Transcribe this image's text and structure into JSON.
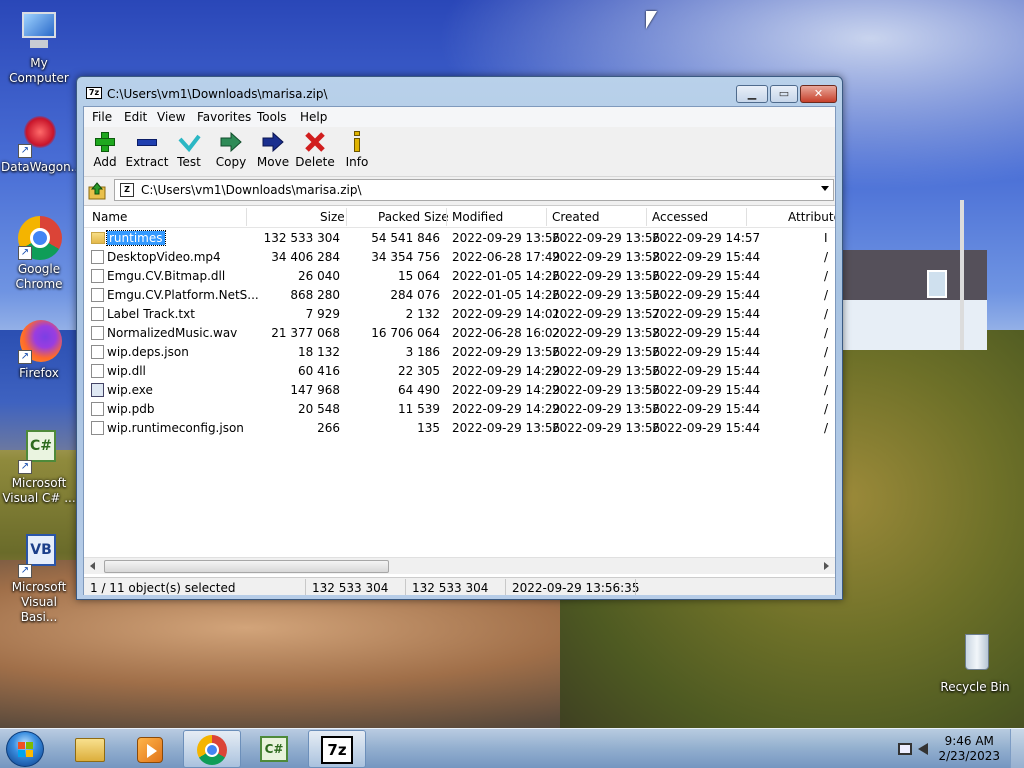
{
  "desktop": {
    "icons": [
      {
        "label": "My Computer",
        "icon": "computer-icon"
      },
      {
        "label": "DataWagon...",
        "icon": "datawagon-icon"
      },
      {
        "label": "Google Chrome",
        "icon": "chrome-icon"
      },
      {
        "label": "Firefox",
        "icon": "firefox-icon"
      },
      {
        "label": "Microsoft Visual C# ...",
        "icon": "visual-csharp-icon"
      },
      {
        "label": "Microsoft Visual Basi...",
        "icon": "visual-basic-icon"
      },
      {
        "label": "Recycle Bin",
        "icon": "recycle-bin-icon"
      }
    ]
  },
  "window": {
    "title": "C:\\Users\\vm1\\Downloads\\marisa.zip\\",
    "app_icon_text": "7z",
    "menu": [
      "File",
      "Edit",
      "View",
      "Favorites",
      "Tools",
      "Help"
    ],
    "toolbar": [
      {
        "label": "Add",
        "icon": "plus-icon",
        "color": "#1fa81f"
      },
      {
        "label": "Extract",
        "icon": "minus-icon",
        "color": "#1f3fb0"
      },
      {
        "label": "Test",
        "icon": "check-icon",
        "color": "#2bb7c4"
      },
      {
        "label": "Copy",
        "icon": "double-arrow-icon",
        "color": "#2e8b57"
      },
      {
        "label": "Move",
        "icon": "arrow-right-icon",
        "color": "#1a2f8f"
      },
      {
        "label": "Delete",
        "icon": "x-icon",
        "color": "#d11e1e"
      },
      {
        "label": "Info",
        "icon": "info-icon",
        "color": "#e0b400"
      }
    ],
    "address": "C:\\Users\\vm1\\Downloads\\marisa.zip\\",
    "columns": [
      "Name",
      "Size",
      "Packed Size",
      "Modified",
      "Created",
      "Accessed",
      "Attribute"
    ],
    "files": [
      {
        "name": "runtimes",
        "type": "folder",
        "size": "132 533 304",
        "packed": "54 541 846",
        "modified": "2022-09-29 13:56",
        "created": "2022-09-29 13:56",
        "accessed": "2022-09-29 14:57",
        "attr": "I",
        "selected": true
      },
      {
        "name": "DesktopVideo.mp4",
        "type": "video",
        "size": "34 406 284",
        "packed": "34 354 756",
        "modified": "2022-06-28 17:49",
        "created": "2022-09-29 13:58",
        "accessed": "2022-09-29 15:44",
        "attr": "/"
      },
      {
        "name": "Emgu.CV.Bitmap.dll",
        "type": "dll",
        "size": "26 040",
        "packed": "15 064",
        "modified": "2022-01-05 14:26",
        "created": "2022-09-29 13:56",
        "accessed": "2022-09-29 15:44",
        "attr": "/"
      },
      {
        "name": "Emgu.CV.Platform.NetS...",
        "type": "dll",
        "size": "868 280",
        "packed": "284 076",
        "modified": "2022-01-05 14:26",
        "created": "2022-09-29 13:56",
        "accessed": "2022-09-29 15:44",
        "attr": "/"
      },
      {
        "name": "Label Track.txt",
        "type": "file",
        "size": "7 929",
        "packed": "2 132",
        "modified": "2022-09-29 14:01",
        "created": "2022-09-29 13:57",
        "accessed": "2022-09-29 15:44",
        "attr": "/"
      },
      {
        "name": "NormalizedMusic.wav",
        "type": "audio",
        "size": "21 377 068",
        "packed": "16 706 064",
        "modified": "2022-06-28 16:02",
        "created": "2022-09-29 13:58",
        "accessed": "2022-09-29 15:44",
        "attr": "/"
      },
      {
        "name": "wip.deps.json",
        "type": "file",
        "size": "18 132",
        "packed": "3 186",
        "modified": "2022-09-29 13:56",
        "created": "2022-09-29 13:56",
        "accessed": "2022-09-29 15:44",
        "attr": "/"
      },
      {
        "name": "wip.dll",
        "type": "dll",
        "size": "60 416",
        "packed": "22 305",
        "modified": "2022-09-29 14:29",
        "created": "2022-09-29 13:56",
        "accessed": "2022-09-29 15:44",
        "attr": "/"
      },
      {
        "name": "wip.exe",
        "type": "exe",
        "size": "147 968",
        "packed": "64 490",
        "modified": "2022-09-29 14:29",
        "created": "2022-09-29 13:56",
        "accessed": "2022-09-29 15:44",
        "attr": "/"
      },
      {
        "name": "wip.pdb",
        "type": "file",
        "size": "20 548",
        "packed": "11 539",
        "modified": "2022-09-29 14:29",
        "created": "2022-09-29 13:56",
        "accessed": "2022-09-29 15:44",
        "attr": "/"
      },
      {
        "name": "wip.runtimeconfig.json",
        "type": "file",
        "size": "266",
        "packed": "135",
        "modified": "2022-09-29 13:56",
        "created": "2022-09-29 13:56",
        "accessed": "2022-09-29 15:44",
        "attr": "/"
      }
    ],
    "status": {
      "selection": "1 / 11 object(s) selected",
      "size": "132 533 304",
      "packed": "132 533 304",
      "modified": "2022-09-29 13:56:35"
    }
  },
  "taskbar": {
    "apps": [
      {
        "name": "file-explorer",
        "icon": "folder-icon"
      },
      {
        "name": "media-player",
        "icon": "media-player-icon"
      },
      {
        "name": "google-chrome",
        "icon": "chrome-icon"
      },
      {
        "name": "visual-csharp",
        "icon": "visual-csharp-icon"
      },
      {
        "name": "7-zip",
        "icon": "7zip-icon",
        "active": true
      }
    ],
    "time": "9:46 AM",
    "date": "2/23/2023"
  }
}
